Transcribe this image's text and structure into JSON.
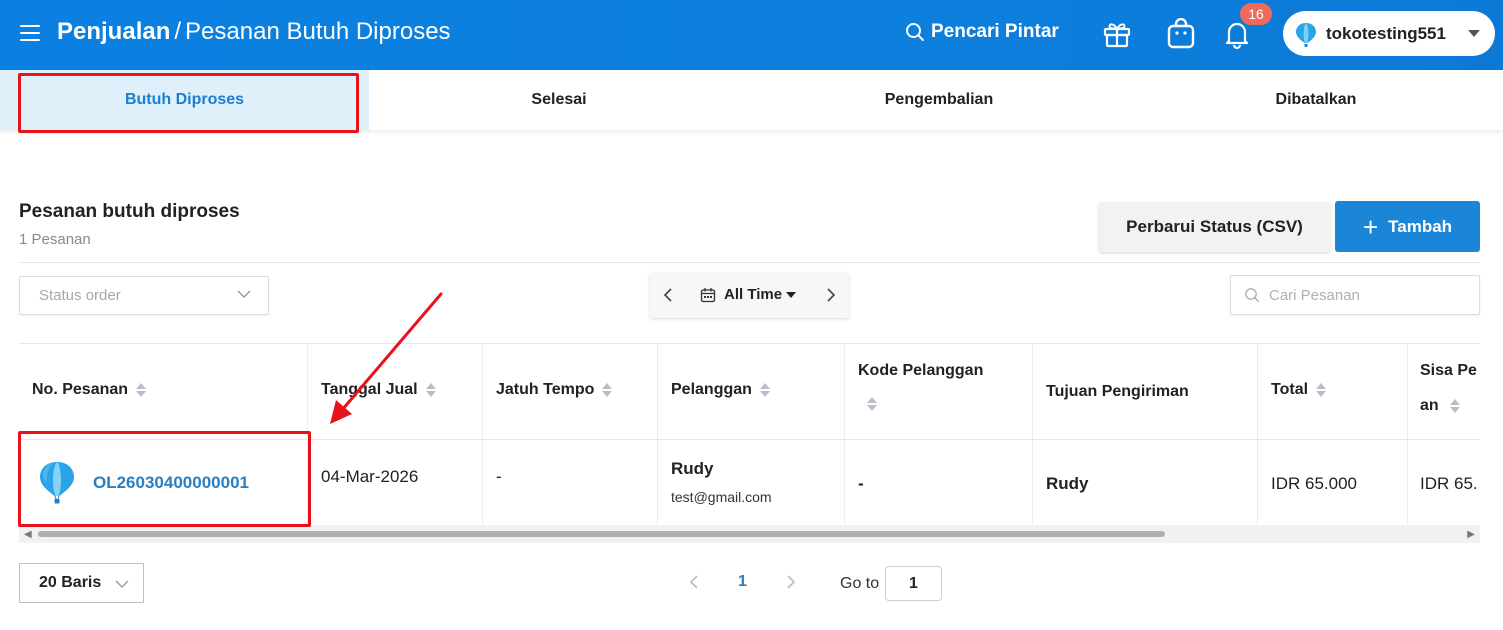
{
  "header": {
    "title_main": "Penjualan",
    "title_sep": "/",
    "title_sub": "Pesanan Butuh Diproses",
    "smart_search": "Pencari Pintar",
    "notification_count": "16",
    "account_name": "tokotesting551",
    "icons": [
      "menu-icon",
      "search-icon",
      "gift-icon",
      "shopping-bag-icon",
      "bell-icon",
      "balloon-logo-icon",
      "caret-down-icon"
    ]
  },
  "tabs": [
    {
      "label": "Butuh Diproses",
      "active": true
    },
    {
      "label": "Selesai",
      "active": false
    },
    {
      "label": "Pengembalian",
      "active": false
    },
    {
      "label": "Dibatalkan",
      "active": false
    }
  ],
  "section": {
    "title": "Pesanan butuh diproses",
    "count": "1 Pesanan",
    "csv_button": "Perbarui Status (CSV)",
    "add_button": "Tambah",
    "add_icon": "+"
  },
  "filters": {
    "status_placeholder": "Status order",
    "date_label": "All Time",
    "search_placeholder": "Cari Pesanan"
  },
  "table": {
    "headers": [
      "No. Pesanan",
      "Tanggal Jual",
      "Jatuh Tempo",
      "Pelanggan",
      "Kode Pelanggan",
      "Tujuan Pengiriman",
      "Total",
      "Sisa Pesanan"
    ],
    "header_lines": {
      "kode_pelanggan": "Kode Pelanggan",
      "sisa_line1": "Sisa Pe",
      "sisa_line2": "an"
    },
    "rows": [
      {
        "order_no": "OL26030400000001",
        "sale_date": "04-Mar-2026",
        "due_date": "-",
        "customer_name": "Rudy",
        "customer_email": "test@gmail.com",
        "customer_code": "-",
        "destination": "Rudy",
        "total": "IDR 65.000",
        "remaining": "IDR 65."
      }
    ]
  },
  "pagination": {
    "rows_per_page": "20 Baris",
    "current_page": "1",
    "goto_label": "Go to",
    "goto_value": "1"
  },
  "colors": {
    "header_bg": "#0b80e0",
    "accent": "#1b86d8",
    "link": "#2a7fbf",
    "badge": "#f06a5b",
    "highlight": "#e8121b",
    "active_tab_bg": "#dff0fb"
  }
}
